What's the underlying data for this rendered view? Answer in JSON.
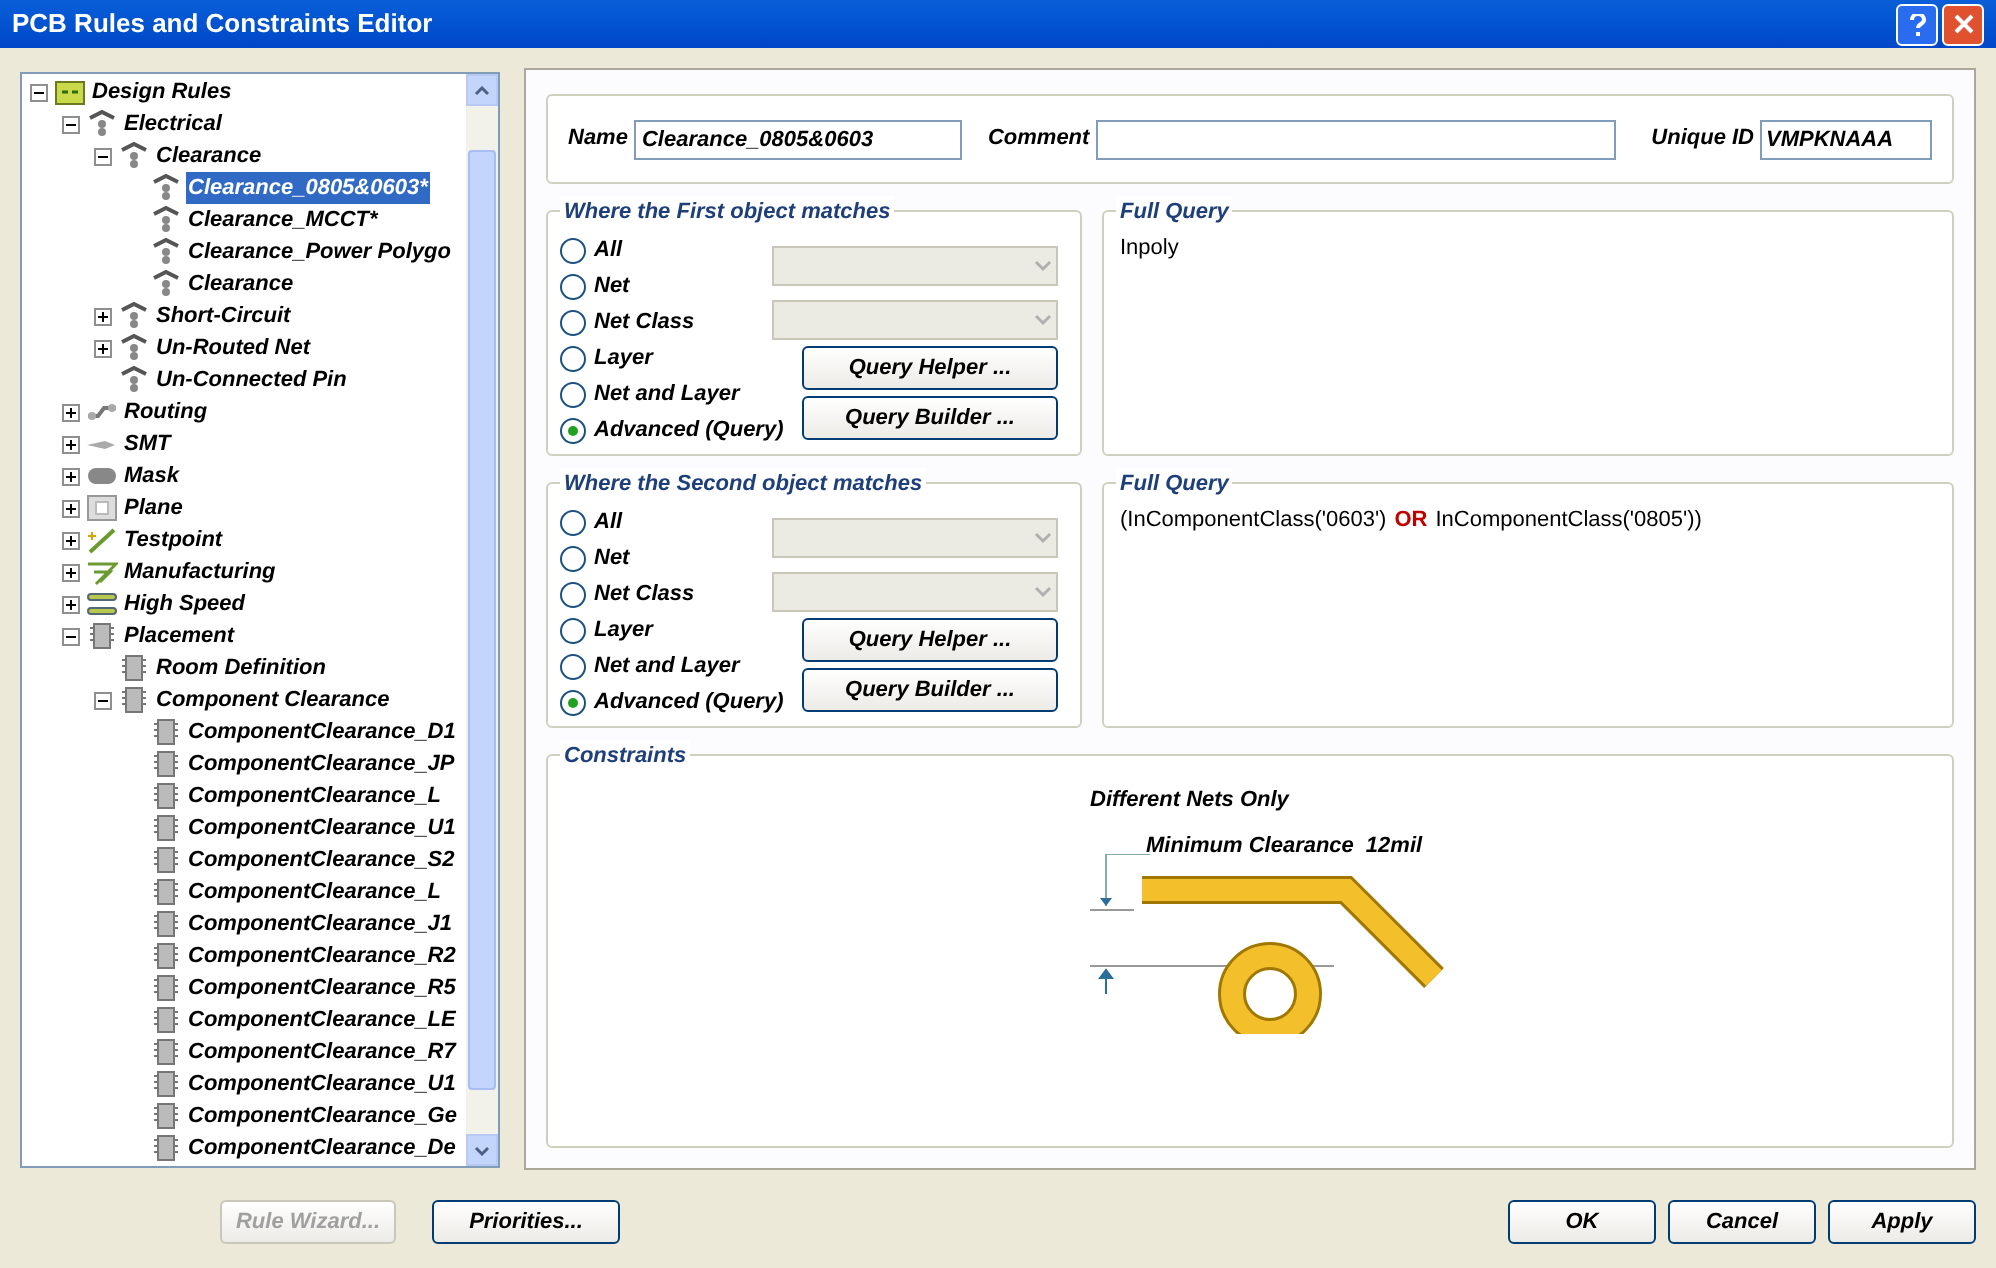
{
  "window": {
    "title": "PCB Rules and Constraints Editor"
  },
  "tree": [
    {
      "label": "Design Rules",
      "kind": "folder",
      "expanded": true,
      "selected": false,
      "children": [
        {
          "label": "Electrical",
          "kind": "rule",
          "expanded": true,
          "selected": false,
          "children": [
            {
              "label": "Clearance",
              "kind": "rule",
              "expanded": true,
              "selected": false,
              "children": [
                {
                  "label": "Clearance_0805&0603*",
                  "kind": "rule",
                  "selected": true
                },
                {
                  "label": "Clearance_MCCT*",
                  "kind": "rule",
                  "selected": false
                },
                {
                  "label": "Clearance_Power Polygo",
                  "kind": "rule",
                  "selected": false
                },
                {
                  "label": "Clearance",
                  "kind": "rule",
                  "selected": false
                }
              ]
            },
            {
              "label": "Short-Circuit",
              "kind": "rule",
              "expanded": false,
              "selected": false
            },
            {
              "label": "Un-Routed Net",
              "kind": "rule",
              "expanded": false,
              "selected": false
            },
            {
              "label": "Un-Connected Pin",
              "kind": "rule",
              "selected": false
            }
          ]
        },
        {
          "label": "Routing",
          "kind": "routing",
          "expanded": false,
          "selected": false
        },
        {
          "label": "SMT",
          "kind": "smt",
          "expanded": false,
          "selected": false
        },
        {
          "label": "Mask",
          "kind": "mask",
          "expanded": false,
          "selected": false
        },
        {
          "label": "Plane",
          "kind": "plane",
          "expanded": false,
          "selected": false
        },
        {
          "label": "Testpoint",
          "kind": "testpoint",
          "expanded": false,
          "selected": false
        },
        {
          "label": "Manufacturing",
          "kind": "manufacturing",
          "expanded": false,
          "selected": false
        },
        {
          "label": "High Speed",
          "kind": "highspeed",
          "expanded": false,
          "selected": false
        },
        {
          "label": "Placement",
          "kind": "placement",
          "expanded": true,
          "selected": false,
          "children": [
            {
              "label": "Room Definition",
              "kind": "placement",
              "selected": false
            },
            {
              "label": "Component Clearance",
              "kind": "placement",
              "expanded": true,
              "selected": false,
              "children": [
                {
                  "label": "ComponentClearance_D1",
                  "kind": "placement",
                  "selected": false
                },
                {
                  "label": "ComponentClearance_JP",
                  "kind": "placement",
                  "selected": false
                },
                {
                  "label": "ComponentClearance_L",
                  "kind": "placement",
                  "selected": false
                },
                {
                  "label": "ComponentClearance_U1",
                  "kind": "placement",
                  "selected": false
                },
                {
                  "label": "ComponentClearance_S2",
                  "kind": "placement",
                  "selected": false
                },
                {
                  "label": "ComponentClearance_L",
                  "kind": "placement",
                  "selected": false
                },
                {
                  "label": "ComponentClearance_J1",
                  "kind": "placement",
                  "selected": false
                },
                {
                  "label": "ComponentClearance_R2",
                  "kind": "placement",
                  "selected": false
                },
                {
                  "label": "ComponentClearance_R5",
                  "kind": "placement",
                  "selected": false
                },
                {
                  "label": "ComponentClearance_LE",
                  "kind": "placement",
                  "selected": false
                },
                {
                  "label": "ComponentClearance_R7",
                  "kind": "placement",
                  "selected": false
                },
                {
                  "label": "ComponentClearance_U1",
                  "kind": "placement",
                  "selected": false
                },
                {
                  "label": "ComponentClearance_Ge",
                  "kind": "placement",
                  "selected": false
                },
                {
                  "label": "ComponentClearance_De",
                  "kind": "placement",
                  "selected": false
                }
              ]
            }
          ]
        }
      ]
    }
  ],
  "header": {
    "name_label": "Name",
    "name_value": "Clearance_0805&0603",
    "comment_label": "Comment",
    "unique_id_label": "Unique ID",
    "unique_id_value": "VMPKNAAA"
  },
  "matches": [
    {
      "title": "Where the First object matches",
      "options": [
        {
          "label": "All",
          "selected": false
        },
        {
          "label": "Net",
          "selected": false
        },
        {
          "label": "Net Class",
          "selected": false
        },
        {
          "label": "Layer",
          "selected": false
        },
        {
          "label": "Net and Layer",
          "selected": false
        },
        {
          "label": "Advanced (Query)",
          "selected": true
        }
      ],
      "buttons": [
        "Query Helper ...",
        "Query Builder ..."
      ],
      "query_title": "Full Query",
      "query": [
        {
          "kind": "text",
          "text": "Inpoly"
        }
      ]
    },
    {
      "title": "Where the Second object matches",
      "options": [
        {
          "label": "All",
          "selected": false
        },
        {
          "label": "Net",
          "selected": false
        },
        {
          "label": "Net Class",
          "selected": false
        },
        {
          "label": "Layer",
          "selected": false
        },
        {
          "label": "Net and Layer",
          "selected": false
        },
        {
          "label": "Advanced (Query)",
          "selected": true
        }
      ],
      "buttons": [
        "Query Helper ...",
        "Query Builder ..."
      ],
      "query_title": "Full Query",
      "query": [
        {
          "kind": "text",
          "text": "(InComponentClass('0603')"
        },
        {
          "kind": "keyword",
          "text": "OR"
        },
        {
          "kind": "text",
          "text": "InComponentClass('0805'))"
        }
      ]
    }
  ],
  "constraints": {
    "title": "Constraints",
    "scope": "Different Nets Only",
    "label": "Minimum Clearance",
    "value": "12mil"
  },
  "buttons": [
    {
      "label": "Rule Wizard...",
      "disabled": true
    },
    {
      "label": "Priorities...",
      "disabled": false
    },
    {
      "label": "OK",
      "disabled": false
    },
    {
      "label": "Cancel",
      "disabled": false
    },
    {
      "label": "Apply",
      "disabled": false
    }
  ]
}
